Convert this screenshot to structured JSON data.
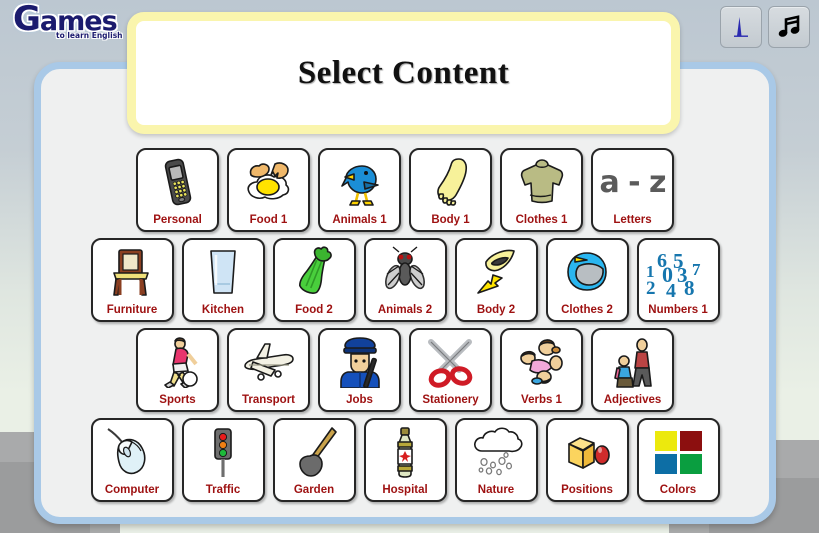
{
  "brand": {
    "logo_main": "ames",
    "logo_big_letter": "G",
    "logo_tagline": "to learn English"
  },
  "toolbar": {
    "sound_button": "sound-level-button",
    "music_button": "music-toggle-button"
  },
  "title": {
    "heading": "Select Content"
  },
  "colors": {
    "panel_border": "#a9c9e7",
    "panel_bg": "#eff0f0",
    "banner_border": "#faf5ad",
    "label_red": "#9e1111",
    "logo_blue": "#1b1b6e",
    "numbers_blue": "#1676ae",
    "letters_gray": "#5b5b5b"
  },
  "letters_tile_text": "a - z",
  "numbers_tile_digits": [
    "1",
    "6",
    "5",
    "7",
    "2",
    "0",
    "3",
    "4",
    "8"
  ],
  "colors_tile_swatches": [
    "#ece90d",
    "#8c0f0f",
    "#0d6ea5",
    "#0a9e40"
  ],
  "grid": {
    "rows": [
      {
        "tiles": [
          {
            "label": "Personal",
            "icon": "mobile-phone-icon"
          },
          {
            "label": "Food 1",
            "icon": "fried-egg-icon"
          },
          {
            "label": "Animals 1",
            "icon": "blue-bird-icon"
          },
          {
            "label": "Body 1",
            "icon": "foot-icon"
          },
          {
            "label": "Clothes 1",
            "icon": "sweater-icon"
          },
          {
            "label": "Letters",
            "icon": "a-z-text-icon"
          }
        ]
      },
      {
        "tiles": [
          {
            "label": "Furniture",
            "icon": "chair-icon"
          },
          {
            "label": "Kitchen",
            "icon": "drinking-glass-icon"
          },
          {
            "label": "Food 2",
            "icon": "celery-icon"
          },
          {
            "label": "Animals 2",
            "icon": "fly-insect-icon"
          },
          {
            "label": "Body 2",
            "icon": "eyebrow-arrow-icon"
          },
          {
            "label": "Clothes 2",
            "icon": "helmet-icon"
          },
          {
            "label": "Numbers 1",
            "icon": "digits-icon"
          }
        ]
      },
      {
        "tiles": [
          {
            "label": "Sports",
            "icon": "soccer-player-icon"
          },
          {
            "label": "Transport",
            "icon": "airplane-icon"
          },
          {
            "label": "Jobs",
            "icon": "policeman-icon"
          },
          {
            "label": "Stationery",
            "icon": "scissors-icon"
          },
          {
            "label": "Verbs 1",
            "icon": "people-faces-icon"
          },
          {
            "label": "Adjectives",
            "icon": "two-people-icon"
          }
        ]
      },
      {
        "tiles": [
          {
            "label": "Computer",
            "icon": "computer-mouse-icon"
          },
          {
            "label": "Traffic",
            "icon": "traffic-light-icon"
          },
          {
            "label": "Garden",
            "icon": "spade-icon"
          },
          {
            "label": "Hospital",
            "icon": "medicine-bottle-icon"
          },
          {
            "label": "Nature",
            "icon": "rain-cloud-icon"
          },
          {
            "label": "Positions",
            "icon": "cube-sphere-icon"
          },
          {
            "label": "Colors",
            "icon": "color-swatches-icon"
          }
        ]
      }
    ]
  }
}
